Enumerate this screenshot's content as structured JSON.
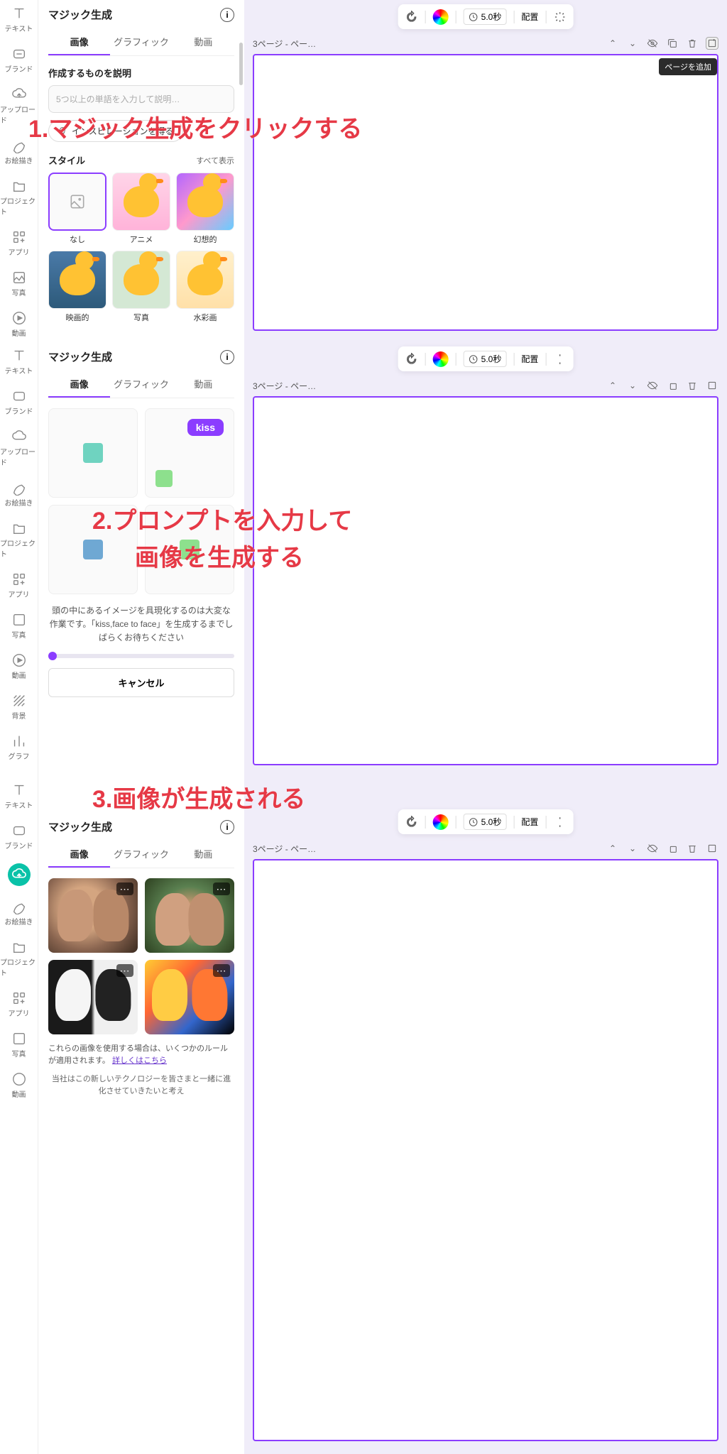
{
  "overlay": {
    "step1": "1.マジック生成をクリックする",
    "step2a": "2.プロンプトを入力して",
    "step2b": "画像を生成する",
    "step3": "3.画像が生成される"
  },
  "sidebar": {
    "items": [
      {
        "label": "テキスト"
      },
      {
        "label": "ブランド"
      },
      {
        "label": "アップロード"
      },
      {
        "label": "お絵描き"
      },
      {
        "label": "プロジェクト"
      },
      {
        "label": "アプリ"
      },
      {
        "label": "写真"
      },
      {
        "label": "動画"
      },
      {
        "label": "背景"
      },
      {
        "label": "グラフ"
      }
    ]
  },
  "panel": {
    "title": "マジック生成",
    "tabs": {
      "image": "画像",
      "graphic": "グラフィック",
      "video": "動画"
    },
    "prompt_label": "作成するものを説明",
    "prompt_placeholder": "5つ以上の単語を入力して説明…",
    "inspiration": "インスピレーションを得る",
    "style_label": "スタイル",
    "view_all": "すべて表示",
    "styles": {
      "none": "なし",
      "anime": "アニメ",
      "fantasy": "幻想的",
      "movie": "映画的",
      "photo": "写真",
      "water": "水彩画"
    }
  },
  "gen": {
    "kiss_badge": "kiss",
    "wait_text": "頭の中にあるイメージを具現化するのは大変な作業です。「kiss,face to face」を生成するまでしばらくお待ちください",
    "cancel": "キャンセル",
    "rules": "これらの画像を使用する場合は、いくつかのルールが適用されます。",
    "rules_link": "詳しくはこちら",
    "company": "当社はこの新しいテクノロジーを皆さまと一緒に進化させていきたいと考え"
  },
  "canvas": {
    "duration": "5.0秒",
    "arrange": "配置",
    "page_label": "3ページ - ペー…",
    "tooltip_add": "ページを追加"
  }
}
